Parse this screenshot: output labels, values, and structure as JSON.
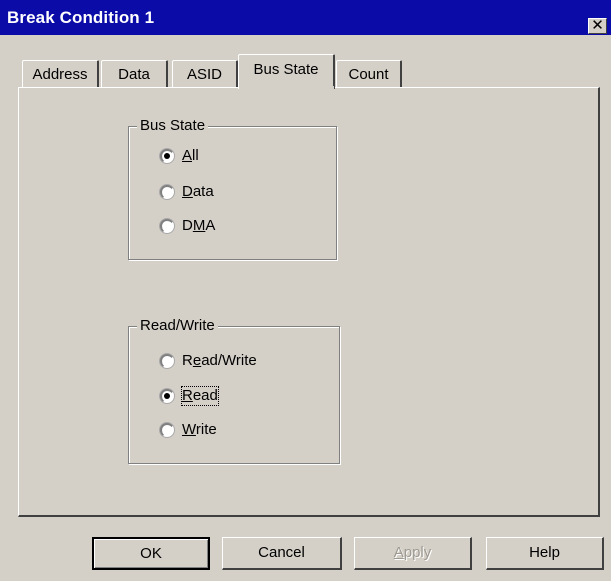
{
  "window": {
    "title": "Break Condition 1",
    "close_glyph": "✕"
  },
  "tabs": [
    {
      "label": "Address",
      "active": false
    },
    {
      "label": "Data",
      "active": false
    },
    {
      "label": "ASID",
      "active": false
    },
    {
      "label": "Bus State",
      "active": true
    },
    {
      "label": "Count",
      "active": false
    }
  ],
  "bus_state_group": {
    "title": "Bus State",
    "options": [
      {
        "label": "All",
        "mnemonic": "A",
        "rest": "ll",
        "checked": true
      },
      {
        "label": "Data",
        "mnemonic": "D",
        "rest": "ata",
        "checked": false
      },
      {
        "label": "DMA",
        "pre": "D",
        "mnemonic": "M",
        "rest": "A",
        "checked": false
      }
    ]
  },
  "read_write_group": {
    "title": "Read/Write",
    "options": [
      {
        "label": "Read/Write",
        "pre": "R",
        "mnemonic": "e",
        "rest": "ad/Write",
        "checked": false
      },
      {
        "label": "Read",
        "mnemonic": "R",
        "rest": "ead",
        "checked": true
      },
      {
        "label": "Write",
        "mnemonic": "W",
        "rest": "rite",
        "checked": false
      }
    ]
  },
  "buttons": {
    "ok": "OK",
    "cancel": "Cancel",
    "apply": {
      "pre": "",
      "mnemonic": "A",
      "rest": "pply"
    },
    "help": "Help"
  },
  "colors": {
    "titlebar": "#0b0ba8",
    "face": "#d4d0c8",
    "shadow": "#808080",
    "highlight": "#ffffff"
  }
}
